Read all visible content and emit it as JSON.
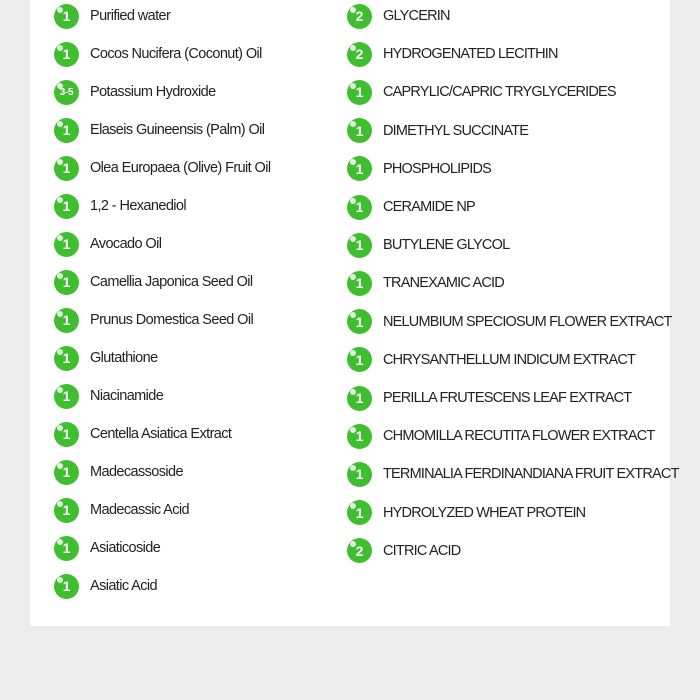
{
  "left_column": [
    {
      "grade": "1",
      "name": "Purified water"
    },
    {
      "grade": "1",
      "name": "Cocos Nucifera (Coconut) Oil"
    },
    {
      "grade": "3-5",
      "name": "Potassium Hydroxide"
    },
    {
      "grade": "1",
      "name": "Elaseis Guineensis (Palm) Oil"
    },
    {
      "grade": "1",
      "name": "Olea Europaea (Olive) Fruit Oil"
    },
    {
      "grade": "1",
      "name": "1,2 - Hexanediol"
    },
    {
      "grade": "1",
      "name": "Avocado Oil"
    },
    {
      "grade": "1",
      "name": "Camellia Japonica Seed Oil"
    },
    {
      "grade": "1",
      "name": "Prunus Domestica Seed Oil"
    },
    {
      "grade": "1",
      "name": "Glutathione"
    },
    {
      "grade": "1",
      "name": "Niacinamide"
    },
    {
      "grade": "1",
      "name": "Centella Asiatica Extract"
    },
    {
      "grade": "1",
      "name": "Madecassoside"
    },
    {
      "grade": "1",
      "name": "Madecassic Acid"
    },
    {
      "grade": "1",
      "name": "Asiaticoside"
    },
    {
      "grade": "1",
      "name": "Asiatic Acid"
    }
  ],
  "right_column": [
    {
      "grade": "2",
      "name": "GLYCERIN"
    },
    {
      "grade": "2",
      "name": "HYDROGENATED LECITHIN"
    },
    {
      "grade": "1",
      "name": "CAPRYLIC/CAPRIC TRYGLYCERIDES"
    },
    {
      "grade": "1",
      "name": "DIMETHYL SUCCINATE"
    },
    {
      "grade": "1",
      "name": "PHOSPHOLIPIDS"
    },
    {
      "grade": "1",
      "name": "CERAMIDE NP"
    },
    {
      "grade": "1",
      "name": "BUTYLENE GLYCOL"
    },
    {
      "grade": "1",
      "name": "TRANEXAMIC ACID"
    },
    {
      "grade": "1",
      "name": "NELUMBIUM SPECIOSUM FLOWER EXTRACT"
    },
    {
      "grade": "1",
      "name": "CHRYSANTHELLUM INDICUM EXTRACT"
    },
    {
      "grade": "1",
      "name": "PERILLA FRUTESCENS LEAF EXTRACT"
    },
    {
      "grade": "1",
      "name": "CHMOMILLA RECUTITA FLOWER EXTRACT"
    },
    {
      "grade": "1",
      "name": "TERMINALIA FERDINANDIANA FRUIT EXTRACT"
    },
    {
      "grade": "1",
      "name": "HYDROLYZED WHEAT PROTEIN"
    },
    {
      "grade": "2",
      "name": "CITRIC ACID"
    }
  ],
  "colors": {
    "badge": "#3fbe2f",
    "background": "#ececec",
    "card": "#ffffff"
  }
}
